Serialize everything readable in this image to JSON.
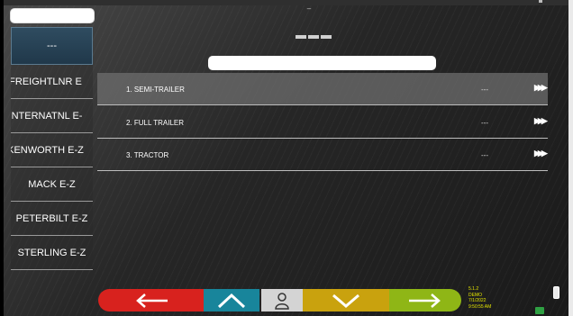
{
  "header": {
    "top_indicator": "–",
    "center_indicator": "==="
  },
  "sidebar": {
    "selected_label": "---",
    "items": [
      {
        "label": "FREIGHTLNR E"
      },
      {
        "label": "INTERNATNL E-"
      },
      {
        "label": "KENWORTH E-Z"
      },
      {
        "label": "MACK E-Z"
      },
      {
        "label": "PETERBILT E-Z"
      },
      {
        "label": "STERLING E-Z"
      }
    ]
  },
  "list": {
    "rows": [
      {
        "label": "1. SEMI-TRAILER",
        "value": "---",
        "go_icon": "triple-chevron-right-icon"
      },
      {
        "label": "2. FULL TRAILER",
        "value": "---",
        "go_icon": "triple-chevron-right-icon"
      },
      {
        "label": "3. TRACTOR",
        "value": "---",
        "go_icon": "triple-chevron-right-icon"
      }
    ]
  },
  "toolbar": {
    "buttons": [
      {
        "icon": "arrow-left-icon",
        "color": "#d8221e"
      },
      {
        "icon": "chevron-up-icon",
        "color": "#18859b"
      },
      {
        "icon": "user-icon",
        "color": "#d4d4d4"
      },
      {
        "icon": "chevron-down-icon",
        "color": "#c9a20e"
      },
      {
        "icon": "arrow-right-icon",
        "color": "#8fb616"
      }
    ]
  },
  "status": {
    "version": "5.1.2",
    "mode": "DEMO",
    "date": "7/1/2022",
    "time": "9:50:55 AM"
  }
}
